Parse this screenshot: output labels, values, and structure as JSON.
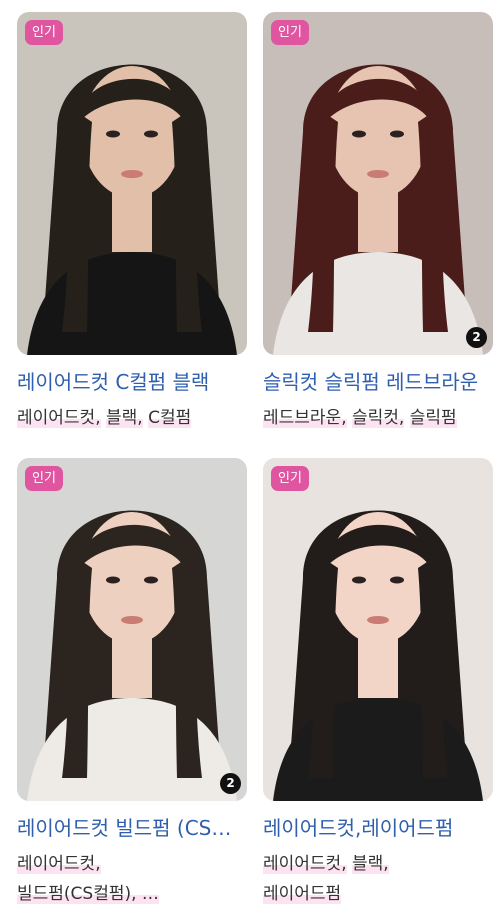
{
  "cards": [
    {
      "badge": "인기",
      "count": "",
      "title": "레이어드컷 C컬펌 블랙",
      "tags": [
        "레이어드컷,",
        "블랙,",
        "C컬펌"
      ],
      "colors": {
        "bg": "#c9c5bd",
        "hair": "#26201b",
        "skin": "#e2bfa8",
        "cloth": "#151515"
      }
    },
    {
      "badge": "인기",
      "count": "2",
      "title": "슬릭컷 슬릭펌 레드브라운",
      "tags": [
        "레드브라운,",
        "슬릭컷,",
        "슬릭펌"
      ],
      "colors": {
        "bg": "#c8beb9",
        "hair": "#4a1d1a",
        "skin": "#e6c4b1",
        "cloth": "#e9e6e4"
      }
    },
    {
      "badge": "인기",
      "count": "2",
      "title": "레이어드컷 빌드펌 (CS컬펌)",
      "tags": [
        "레이어드컷,",
        "빌드펌(CS컬펌), …"
      ],
      "colors": {
        "bg": "#d6d6d4",
        "hair": "#2c251f",
        "skin": "#edd0bf",
        "cloth": "#eeeae6"
      }
    },
    {
      "badge": "인기",
      "count": "",
      "title": "레이어드컷,레이어드펌",
      "tags": [
        "레이어드컷,",
        "블랙,",
        "레이어드펌"
      ],
      "colors": {
        "bg": "#e8e3df",
        "hair": "#221d1a",
        "skin": "#f2d5c6",
        "cloth": "#1b1b1b"
      }
    }
  ]
}
